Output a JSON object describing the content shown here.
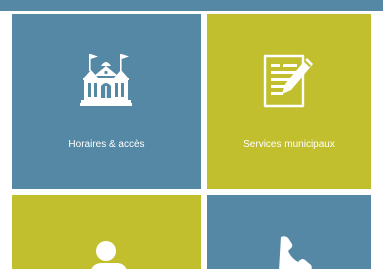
{
  "colors": {
    "tile_blue": "#5588a4",
    "tile_olive": "#c2bf2e",
    "icon_fill": "#ffffff"
  },
  "tiles": [
    {
      "id": "top-partial",
      "icon": "",
      "label": ""
    },
    {
      "id": "horaires",
      "icon": "town-hall-icon",
      "label": "Horaires & accès"
    },
    {
      "id": "services",
      "icon": "form-pencil-icon",
      "label": "Services municipaux"
    },
    {
      "id": "partial-left",
      "icon": "person-icon",
      "label": ""
    },
    {
      "id": "partial-right",
      "icon": "phone-icon",
      "label": ""
    }
  ]
}
